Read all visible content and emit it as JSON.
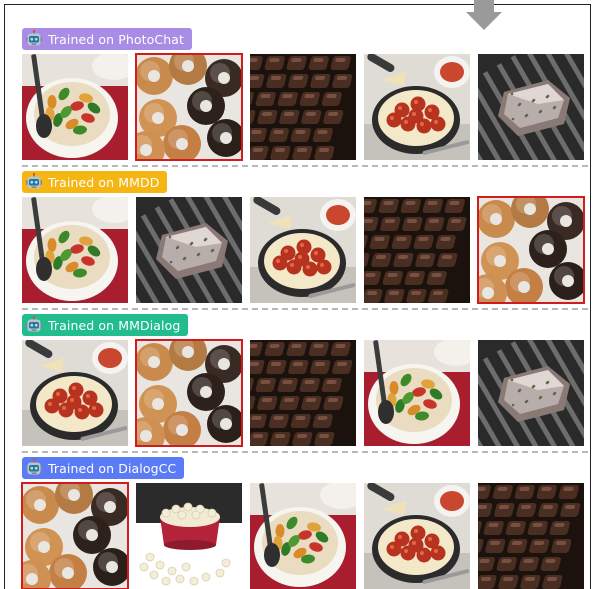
{
  "sections": [
    {
      "label": "Trained on PhotoChat",
      "color": "#a98ce6",
      "images": [
        "pasta-salad",
        "donuts",
        "chocolate-bars",
        "spaghetti-meatballs",
        "grilled-meat"
      ],
      "selected_index": 1
    },
    {
      "label": "Trained on MMDD",
      "color": "#f5b614",
      "images": [
        "pasta-salad",
        "grilled-meat",
        "spaghetti-meatballs",
        "chocolate-bars",
        "donuts"
      ],
      "selected_index": 4
    },
    {
      "label": "Trained on MMDialog",
      "color": "#22bd8f",
      "images": [
        "spaghetti-meatballs",
        "donuts",
        "chocolate-bars",
        "pasta-salad",
        "grilled-meat"
      ],
      "selected_index": 1
    },
    {
      "label": "Trained on DialogCC",
      "color": "#5a7bf5",
      "images": [
        "donuts",
        "popcorn",
        "pasta-salad",
        "spaghetti-meatballs",
        "chocolate-bars"
      ],
      "selected_index": 0
    }
  ],
  "colors": {
    "selection_outline": "#d01c1c",
    "divider": "#b8b8b8"
  },
  "icons": {
    "label_icon": "robot-icon",
    "top_arrow": "arrow-down-icon"
  }
}
